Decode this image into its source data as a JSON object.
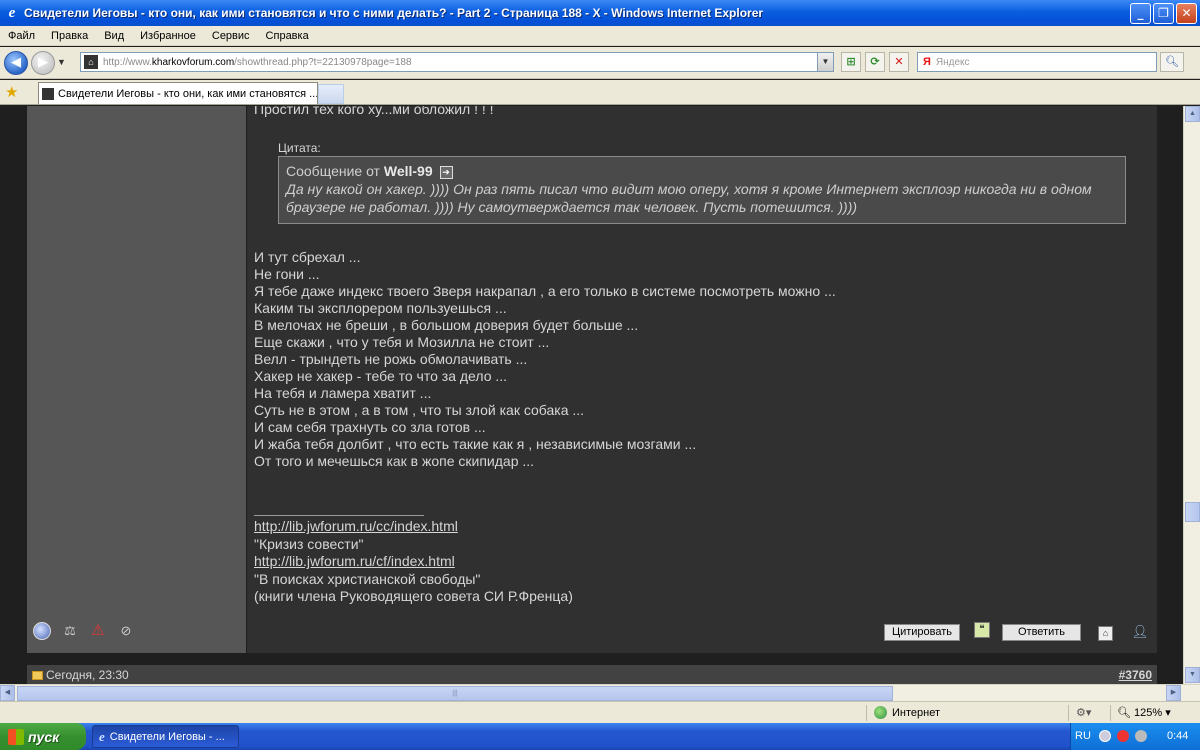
{
  "window": {
    "title": "Свидетели Иеговы - кто они, как ими становятся и что с ними делать? - Part 2 - Страница 188 - X - Windows Internet Explorer",
    "ie_glyph": "e"
  },
  "menu": {
    "items": [
      "Файл",
      "Правка",
      "Вид",
      "Избранное",
      "Сервис",
      "Справка"
    ]
  },
  "address": {
    "prefix": "http://www.",
    "host": "kharkovforum.com",
    "path": "/showthread.php?t=22130978page=188"
  },
  "search": {
    "placeholder": "Яндекс",
    "logo": "Я"
  },
  "tab": {
    "title": "Свидетели Иеговы - кто они, как ими становятся ..."
  },
  "post": {
    "previous_line": "Простил тех кого ху...ми обложил ! ! !",
    "quote_label": "Цитата:",
    "quote_from_prefix": "Сообщение от",
    "quote_author": "Well-99",
    "quote_text": "Да ну какой он хакер. )))) Он раз пять писал что видит мою оперу, хотя я кроме Интернет эксплоэр никогда ни в одном браузере не работал. )))) Ну самоутверждается так человек. Пусть потешится. ))))",
    "message_lines": [
      "И тут сбрехал ...",
      "Не гони ...",
      "Я тебе даже индекс твоего Зверя накрапал , а его только в системе посмотреть можно ...",
      "Каким ты эксплорером пользуешься ...",
      "В мелочах не бреши , в большом доверия будет больше ...",
      "Еще скажи , что у тебя и Мозилла не стоит ...",
      "Велл - трындеть не рожь обмолачивать ...",
      "Хакер не хакер - тебе то что за дело ...",
      "На тебя и ламера хватит ...",
      "Суть не в этом , а в том , что ты злой как собака ...",
      "И сам себя трахнуть со зла готов ...",
      "И жаба тебя долбит , что есть такие как я , независимые мозгами ...",
      "От того и мечешься как в жопе скипидар ..."
    ],
    "signature": {
      "link1": "http://lib.jwforum.ru/cc/index.html",
      "text1": "\"Кризиз совести\"",
      "link2": "http://lib.jwforum.ru/cf/index.html",
      "text2": "\"В поисках христианской свободы\"",
      "text3": "(книги члена Руководящего совета СИ Р.Френца)"
    },
    "quote_button": "Цитировать",
    "reply_button": "Ответить"
  },
  "next_post": {
    "date": "Сегодня, 23:30",
    "number": "#3760"
  },
  "statusbar": {
    "zone": "Интернет",
    "zoom": "125%"
  },
  "taskbar": {
    "start_label": "пуск",
    "task_label": "Свидетели Иеговы - ...",
    "lang": "RU",
    "time": "0:44"
  }
}
